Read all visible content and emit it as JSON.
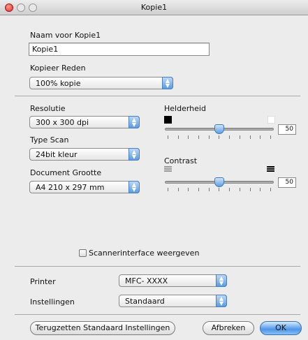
{
  "window": {
    "title": "Kopie1"
  },
  "name_field": {
    "label": "Naam voor Kopie1",
    "value": "Kopie1"
  },
  "copy_reason": {
    "label": "Kopieer Reden",
    "value": "100% kopie"
  },
  "resolution": {
    "label": "Resolutie",
    "value": "300 x 300 dpi"
  },
  "scan_type": {
    "label": "Type Scan",
    "value": "24bit kleur"
  },
  "document_size": {
    "label": "Document Grootte",
    "value": "A4  210 x 297 mm"
  },
  "brightness": {
    "label": "Helderheid",
    "value": "50",
    "level": 0.5
  },
  "contrast": {
    "label": "Contrast",
    "value": "50",
    "level": 0.5
  },
  "scanner_interface": {
    "label": "Scannerinterface weergeven",
    "checked": false
  },
  "printer": {
    "label": "Printer",
    "value": "MFC- XXXX"
  },
  "settings": {
    "label": "Instellingen",
    "value": "Standaard"
  },
  "buttons": {
    "reset": "Terugzetten Standaard Instellingen",
    "cancel": "Afbreken",
    "ok": "OK"
  }
}
